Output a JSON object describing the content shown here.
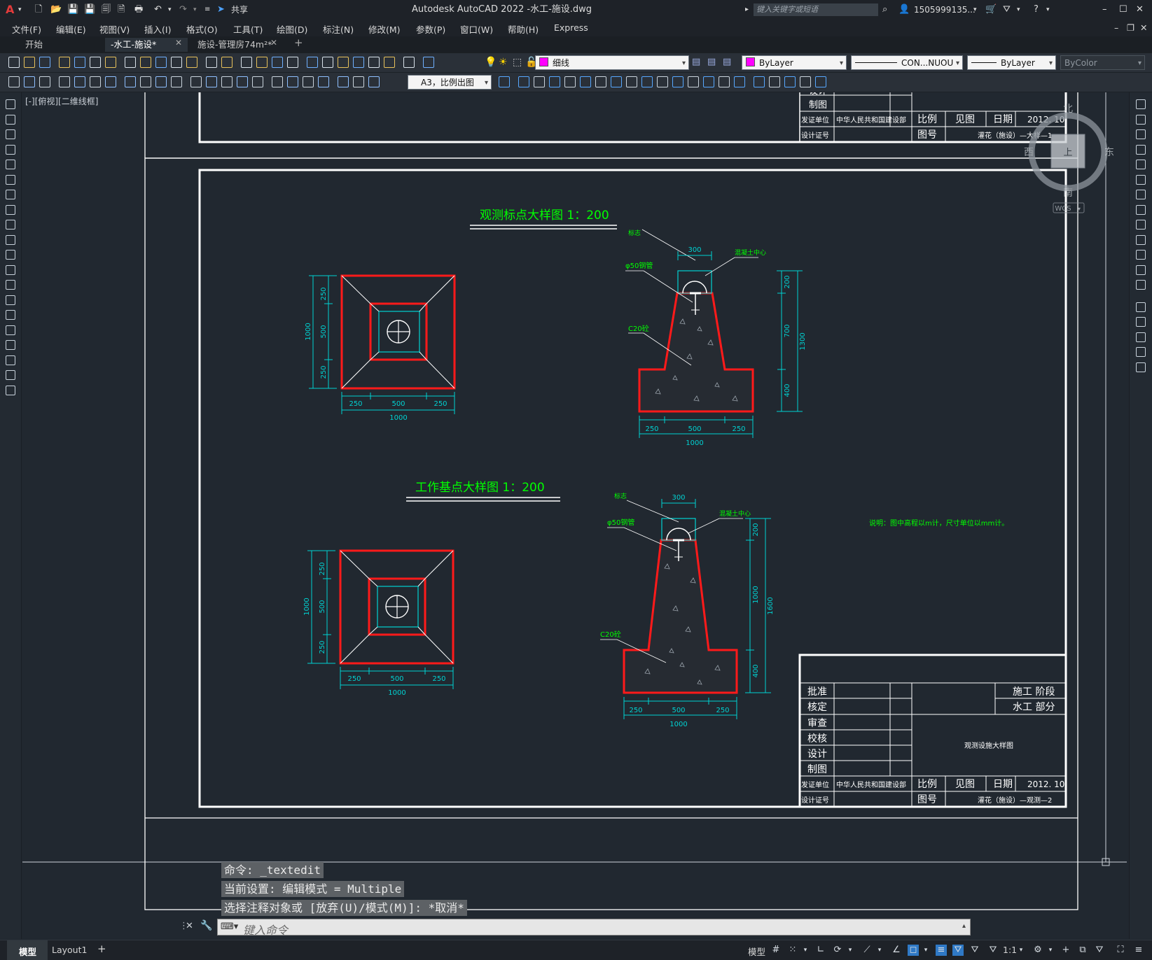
{
  "app": {
    "title": "Autodesk AutoCAD 2022    -水工-施设.dwg",
    "share_label": "共享",
    "search_placeholder": "键入关键字或短语",
    "user": "1505999135...",
    "logo": "A"
  },
  "menu": [
    "文件(F)",
    "编辑(E)",
    "视图(V)",
    "插入(I)",
    "格式(O)",
    "工具(T)",
    "绘图(D)",
    "标注(N)",
    "修改(M)",
    "参数(P)",
    "窗口(W)",
    "帮助(H)",
    "Express"
  ],
  "tabs": [
    {
      "label": "开始",
      "active": false,
      "closable": false
    },
    {
      "label": "-水工-施设*",
      "active": true,
      "closable": true
    },
    {
      "label": "施设-管理房74m²*",
      "active": false,
      "closable": true
    }
  ],
  "toolbar": {
    "layer": "细线",
    "color": "ByLayer",
    "linetype": "CON...NUOU",
    "lineweight": "ByLayer",
    "plotstyle": "ByColor",
    "plot_config": "A3，比例出图",
    "layer_color": "#ff00ff"
  },
  "viewport_label": "[-][俯视][二维线框]",
  "viewcube": {
    "north": "北",
    "south": "南",
    "east": "东",
    "west": "西",
    "center": "上",
    "wcs": "WCS"
  },
  "drawing": {
    "top_title_block": {
      "design_label": "设计",
      "draw_label": "制图",
      "issuer_label": "发证单位",
      "issuer": "中华人民共和国建设部",
      "cert_label": "设计证号",
      "scale_label": "比例",
      "scale_value": "见图",
      "date_label": "日期",
      "date_value": "2012. 10",
      "drawing_no_label": "图号",
      "drawing_no": "灌花（施设）—大样—1"
    },
    "section1_title": "观测标点大样图  1：200",
    "section2_title": "工作基点大样图  1：200",
    "note": "说明：图中高程以m计，尺寸单位以mm计。",
    "plan_dims": {
      "a": "250",
      "b": "500",
      "c": "250",
      "total": "1000"
    },
    "sec1": {
      "top": "300",
      "h1": "200",
      "h2": "700",
      "h3": "400",
      "total": "1300",
      "base": [
        "250",
        "500",
        "250"
      ],
      "base_total": "1000",
      "label_mark": "标志",
      "label_pipe": "φ50钢管",
      "label_concrete": "C20砼",
      "label_center": "混凝土中心"
    },
    "sec2": {
      "top": "300",
      "h1": "200",
      "h2": "1000",
      "h3": "400",
      "total": "1600",
      "base": [
        "250",
        "500",
        "250"
      ],
      "base_total": "1000",
      "label_mark": "标志",
      "label_pipe": "φ50钢管",
      "label_concrete": "C20砼",
      "label_center": "混凝土中心"
    },
    "title_block": {
      "rows": [
        "批准",
        "核定",
        "审查",
        "校核",
        "设计",
        "制图"
      ],
      "stage_label": "施工   阶段",
      "part_label": "水工   部分",
      "drawing_name": "观测设施大样图",
      "issuer_label": "发证单位",
      "issuer": "中华人民共和国建设部",
      "cert_label": "设计证号",
      "scale_label": "比例",
      "scale_value": "见图",
      "date_label": "日期",
      "date_value": "2012. 10",
      "drawing_no_label": "图号",
      "drawing_no": "灌花（施设）—观测—2"
    }
  },
  "command": {
    "history": [
      "命令: _textedit",
      "当前设置: 编辑模式 = Multiple",
      "选择注释对象或 [放弃(U)/模式(M)]: *取消*"
    ],
    "placeholder": "键入命令"
  },
  "status": {
    "layout_tabs": [
      "模型",
      "Layout1"
    ],
    "model_label": "模型",
    "scale": "1:1"
  },
  "colors": {
    "background": "#212830",
    "frame": "#ffffff",
    "red": "#ff1a1a",
    "cyan": "#00d2d2",
    "green": "#00ff00",
    "yellow": "#ffff00"
  }
}
